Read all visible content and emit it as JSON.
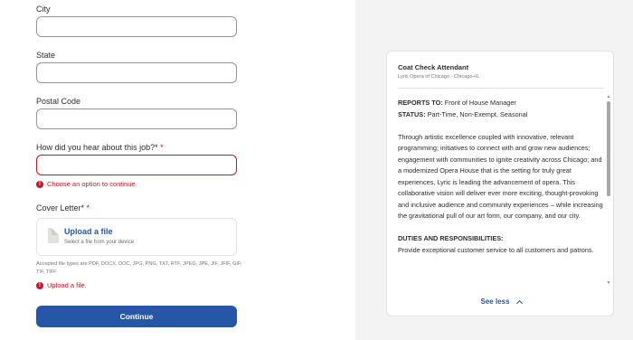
{
  "form": {
    "city_label": "City",
    "state_label": "State",
    "postal_label": "Postal Code",
    "source_label": "How did you hear about this job?*",
    "required_mark": "*",
    "source_error": "Choose an option to continue.",
    "cover_label": "Cover Letter*",
    "upload_title": "Upload a file",
    "upload_sub": "Select a file from your device",
    "accepted_types": "Accepted file types are PDF, DOCX, DOC, JPG, PNG, TXT, RTF, JPEG, JPE, JIF, JFIF, GIF, TIF, TIFF",
    "upload_error": "Upload a file.",
    "error_glyph": "!",
    "continue_label": "Continue"
  },
  "job": {
    "title": "Coat Check Attendant",
    "company_location": "Lyric Opera of Chicago - Chicago+IL",
    "reports_to_key": "REPORTS TO:",
    "reports_to_val": "Front of House Manager",
    "status_key": "STATUS:",
    "status_val": "Part-Time, Non-Exempt, Seasonal",
    "paragraph": "Through artistic excellence coupled with innovative, relevant programming; initiatives to connect with and grow new audiences; engagement with communities to ignite creativity across Chicago; and a modernized Opera House that is the setting for truly great experiences, Lyric is leading the advancement of opera. This collaborative vision will deliver ever more exciting, thought-provoking and inclusive audience and community experiences – while increasing the gravitational pull of our art form, our company, and our city.",
    "duties_heading": "DUTIES AND RESPONSIBILITIES:",
    "duties_text": "Provide exceptional customer service to all customers and patrons.",
    "see_less": "See less"
  },
  "icons": {
    "error": "error-icon",
    "file": "file-icon",
    "chevron": "chevron-up-icon",
    "scroll_up": "▲",
    "scroll_down": "▼"
  },
  "colors": {
    "accent": "#2557a7",
    "error": "#c5172b",
    "border": "#949494",
    "panel_bg": "#f3f3f3"
  }
}
